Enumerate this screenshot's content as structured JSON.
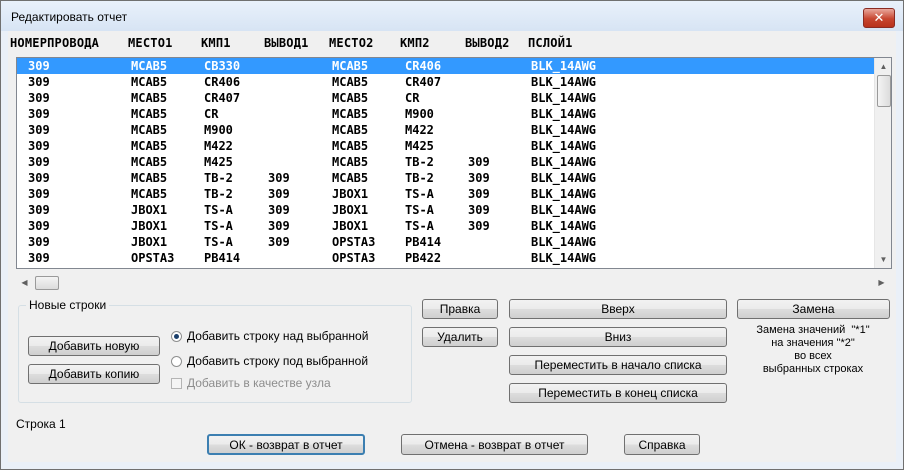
{
  "window": {
    "title": "Редактировать отчет",
    "close_label": "✕"
  },
  "columns": [
    "НОМЕРПРОВОДА",
    "МЕСТО1",
    "КМП1",
    "ВЫВОД1",
    "МЕСТО2",
    "КМП2",
    "ВЫВОД2",
    "ПСЛОЙ1"
  ],
  "rows": [
    [
      "309",
      "MCAB5",
      "CB330",
      "",
      "MCAB5",
      "CR406",
      "",
      "BLK_14AWG"
    ],
    [
      "309",
      "MCAB5",
      "CR406",
      "",
      "MCAB5",
      "CR407",
      "",
      "BLK_14AWG"
    ],
    [
      "309",
      "MCAB5",
      "CR407",
      "",
      "MCAB5",
      "CR",
      "",
      "BLK_14AWG"
    ],
    [
      "309",
      "MCAB5",
      "CR",
      "",
      "MCAB5",
      "M900",
      "",
      "BLK_14AWG"
    ],
    [
      "309",
      "MCAB5",
      "M900",
      "",
      "MCAB5",
      "M422",
      "",
      "BLK_14AWG"
    ],
    [
      "309",
      "MCAB5",
      "M422",
      "",
      "MCAB5",
      "M425",
      "",
      "BLK_14AWG"
    ],
    [
      "309",
      "MCAB5",
      "M425",
      "",
      "MCAB5",
      "TB-2",
      "309",
      "BLK_14AWG"
    ],
    [
      "309",
      "MCAB5",
      "TB-2",
      "309",
      "MCAB5",
      "TB-2",
      "309",
      "BLK_14AWG"
    ],
    [
      "309",
      "MCAB5",
      "TB-2",
      "309",
      "JBOX1",
      "TS-A",
      "309",
      "BLK_14AWG"
    ],
    [
      "309",
      "JBOX1",
      "TS-A",
      "309",
      "JBOX1",
      "TS-A",
      "309",
      "BLK_14AWG"
    ],
    [
      "309",
      "JBOX1",
      "TS-A",
      "309",
      "JBOX1",
      "TS-A",
      "309",
      "BLK_14AWG"
    ],
    [
      "309",
      "JBOX1",
      "TS-A",
      "309",
      "OPSTA3",
      "PB414",
      "",
      "BLK_14AWG"
    ],
    [
      "309",
      "OPSTA3",
      "PB414",
      "",
      "OPSTA3",
      "PB422",
      "",
      "BLK_14AWG"
    ]
  ],
  "selected_row": 0,
  "scroll": {
    "up": "▲",
    "down": "▼",
    "left": "◀",
    "right": "▶"
  },
  "new_rows": {
    "group_label": "Новые строки",
    "add_new": "Добавить новую",
    "add_copy": "Добавить копию",
    "radio_above": "Добавить строку над выбранной",
    "radio_below": "Добавить строку под выбранной",
    "checkbox_node": "Добавить в качестве узла",
    "selected_option": "above"
  },
  "actions": {
    "edit": "Правка",
    "delete": "Удалить",
    "up": "Вверх",
    "down": "Вниз",
    "move_top": "Переместить в начало списка",
    "move_bottom": "Переместить в конец списка",
    "replace": "Замена"
  },
  "replace_note": [
    "Замена значений  \"*1\"",
    "на значения \"*2\"",
    "во всех",
    "выбранных строках"
  ],
  "status": "Строка 1",
  "footer": {
    "ok": "ОК - возврат в отчет",
    "cancel": "Отмена - возврат в отчет",
    "help": "Справка"
  }
}
